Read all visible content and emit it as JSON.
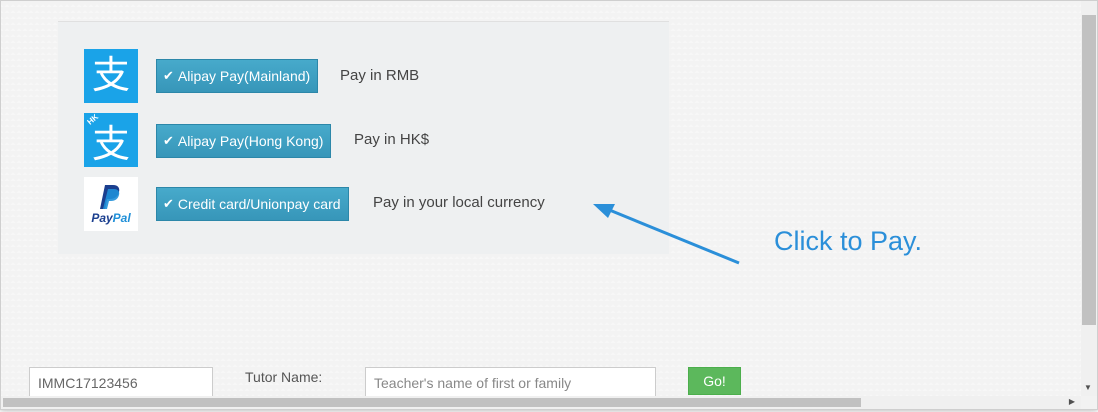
{
  "payment_options": [
    {
      "logo": "alipay-logo",
      "logo_glyph": "支",
      "button_label": "Alipay Pay(Mainland)",
      "note": "Pay in RMB"
    },
    {
      "logo": "alipay-hk-logo",
      "logo_glyph": "支",
      "logo_tag": "HK",
      "button_label": "Alipay Pay(Hong Kong)",
      "note": "Pay in HK$"
    },
    {
      "logo": "paypal-logo",
      "logo_word_a": "Pay",
      "logo_word_b": "Pal",
      "button_label": "Credit card/Unionpay card",
      "note": "Pay in your local currency"
    }
  ],
  "check_glyph": "✔",
  "annotation": {
    "text": "Click to Pay.",
    "color": "#2b8fd9"
  },
  "search": {
    "id_value": "IMMC17123456",
    "tutor_label": "Tutor Name:",
    "tutor_placeholder": "Teacher's name of first or family",
    "go_label": "Go!"
  },
  "colors": {
    "button_blue": "#3f9fc3",
    "go_green": "#5cb85c",
    "alipay_blue": "#1aa3e8"
  }
}
